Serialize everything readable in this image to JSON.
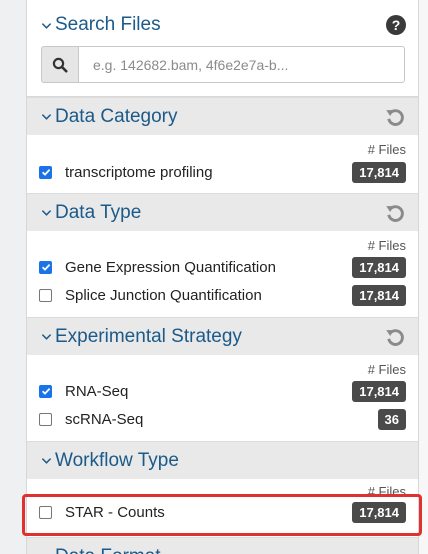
{
  "search": {
    "title": "Search Files",
    "placeholder": "e.g. 142682.bam, 4f6e2e7a-b..."
  },
  "files_label": "# Files",
  "facets": {
    "data_category": {
      "title": "Data Category",
      "items": [
        {
          "label": "transcriptome profiling",
          "count": "17,814",
          "checked": true
        }
      ]
    },
    "data_type": {
      "title": "Data Type",
      "items": [
        {
          "label": "Gene Expression Quantification",
          "count": "17,814",
          "checked": true
        },
        {
          "label": "Splice Junction Quantification",
          "count": "17,814",
          "checked": false
        }
      ]
    },
    "experimental_strategy": {
      "title": "Experimental Strategy",
      "items": [
        {
          "label": "RNA-Seq",
          "count": "17,814",
          "checked": true
        },
        {
          "label": "scRNA-Seq",
          "count": "36",
          "checked": false
        }
      ]
    },
    "workflow_type": {
      "title": "Workflow Type",
      "items": [
        {
          "label": "STAR - Counts",
          "count": "17,814",
          "checked": false
        }
      ]
    },
    "data_format": {
      "title": "Data Format"
    }
  },
  "colors": {
    "heading": "#1b5a89",
    "highlight": "#e03030",
    "badge": "#4a4a4a",
    "checkbox": "#1a73e8"
  },
  "icons": {
    "chevron": "chevron-down-icon",
    "help": "question-circle-icon",
    "search": "magnifier-icon",
    "reset": "undo-icon"
  }
}
